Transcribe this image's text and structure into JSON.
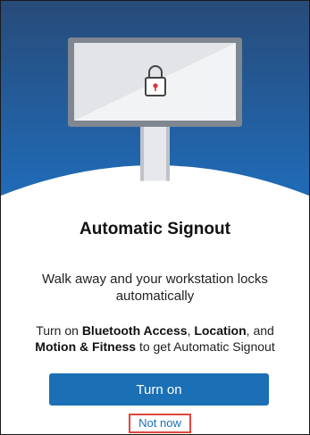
{
  "screen": {
    "title": "Automatic Signout",
    "subtitle": "Walk away and your workstation locks automatically",
    "instructions": {
      "prefix": "Turn on ",
      "bluetooth": "Bluetooth Access",
      "sep1": ", ",
      "location": "Location",
      "sep2": ", and ",
      "motion": "Motion & Fitness",
      "suffix": " to get Automatic Signout"
    }
  },
  "actions": {
    "turn_on_label": "Turn on",
    "not_now_label": "Not now"
  },
  "colors": {
    "header_gradient_top": "#274b79",
    "header_gradient_bottom": "#1f6fbf",
    "primary_button": "#1a6fb5",
    "link_text": "#1a6fb5",
    "highlight_border": "#e0463c",
    "lock_keyhole": "#d9343a"
  },
  "icons": {
    "illustration": "monitor-lock-illustration",
    "lock": "padlock-icon"
  }
}
